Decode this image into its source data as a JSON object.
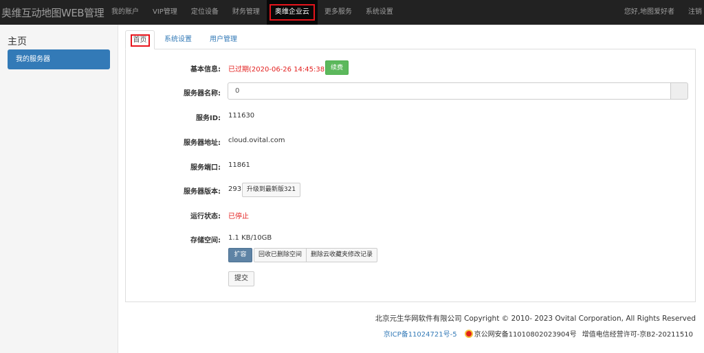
{
  "brand": "奥维互动地图WEB管理",
  "nav": {
    "items": [
      "我的账户",
      "VIP管理",
      "定位设备",
      "财务管理",
      "奥维企业云",
      "更多服务",
      "系统设置"
    ],
    "greeting": "您好,地图爱好者",
    "logout": "注销"
  },
  "sidebar": {
    "title": "主页",
    "items": [
      "我的服务器"
    ]
  },
  "tabs": [
    "首页",
    "系统设置",
    "用户管理"
  ],
  "form": {
    "basic_info_label": "基本信息:",
    "basic_info_value": "已过期(2020-06-26 14:45:38)",
    "renew_label": "续费",
    "server_name_label": "服务器名称:",
    "server_name_value": "0",
    "server_id_label": "服务ID:",
    "server_id_value": "111630",
    "server_addr_label": "服务器地址:",
    "server_addr_value": "cloud.ovital.com",
    "server_port_label": "服务端口:",
    "server_port_value": "11861",
    "server_version_label": "服务器版本:",
    "server_version_value": "293",
    "upgrade_label": "升级到最新版321",
    "run_status_label": "运行状态:",
    "run_status_value": "已停止",
    "storage_label": "存储空间:",
    "storage_value": "1.1 KB/10GB",
    "expand_label": "扩容",
    "recycle_label": "回收已删除空间",
    "delete_log_label": "删除云收藏夹修改记录",
    "submit_label": "提交"
  },
  "footer": {
    "copyright": "北京元生华网软件有限公司 Copyright © 2010- 2023 Ovital Corporation, All Rights Reserved",
    "icp": "京ICP备11024721号-5",
    "police": "京公网安备11010802023904号",
    "license": "增值电信经营许可-京B2-20211510"
  },
  "colors": {
    "navbar": "#222222",
    "highlight_box": "#e8141b",
    "primary": "#337ab7",
    "success": "#5cb85c",
    "danger_text": "#e3201f"
  }
}
